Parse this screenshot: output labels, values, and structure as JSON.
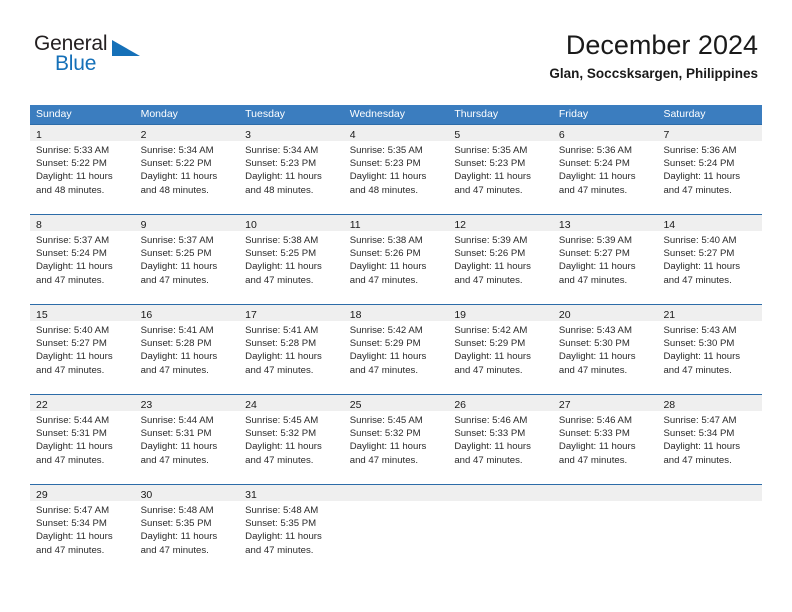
{
  "brand": {
    "name_part1": "General",
    "name_part2": "Blue",
    "logo_icon": "triangle-logo-icon"
  },
  "header": {
    "title": "December 2024",
    "location": "Glan, Soccsksargen, Philippines"
  },
  "colors": {
    "header_blue": "#3b7dbf",
    "row_divider_blue": "#2d6ca8",
    "day_band_gray": "#efefef",
    "brand_blue": "#1570b8",
    "text": "#1a1a1a"
  },
  "weekdays": [
    "Sunday",
    "Monday",
    "Tuesday",
    "Wednesday",
    "Thursday",
    "Friday",
    "Saturday"
  ],
  "weeks": [
    [
      {
        "day": "1",
        "sunrise": "Sunrise: 5:33 AM",
        "sunset": "Sunset: 5:22 PM",
        "daylight_line1": "Daylight: 11 hours",
        "daylight_line2": "and 48 minutes."
      },
      {
        "day": "2",
        "sunrise": "Sunrise: 5:34 AM",
        "sunset": "Sunset: 5:22 PM",
        "daylight_line1": "Daylight: 11 hours",
        "daylight_line2": "and 48 minutes."
      },
      {
        "day": "3",
        "sunrise": "Sunrise: 5:34 AM",
        "sunset": "Sunset: 5:23 PM",
        "daylight_line1": "Daylight: 11 hours",
        "daylight_line2": "and 48 minutes."
      },
      {
        "day": "4",
        "sunrise": "Sunrise: 5:35 AM",
        "sunset": "Sunset: 5:23 PM",
        "daylight_line1": "Daylight: 11 hours",
        "daylight_line2": "and 48 minutes."
      },
      {
        "day": "5",
        "sunrise": "Sunrise: 5:35 AM",
        "sunset": "Sunset: 5:23 PM",
        "daylight_line1": "Daylight: 11 hours",
        "daylight_line2": "and 47 minutes."
      },
      {
        "day": "6",
        "sunrise": "Sunrise: 5:36 AM",
        "sunset": "Sunset: 5:24 PM",
        "daylight_line1": "Daylight: 11 hours",
        "daylight_line2": "and 47 minutes."
      },
      {
        "day": "7",
        "sunrise": "Sunrise: 5:36 AM",
        "sunset": "Sunset: 5:24 PM",
        "daylight_line1": "Daylight: 11 hours",
        "daylight_line2": "and 47 minutes."
      }
    ],
    [
      {
        "day": "8",
        "sunrise": "Sunrise: 5:37 AM",
        "sunset": "Sunset: 5:24 PM",
        "daylight_line1": "Daylight: 11 hours",
        "daylight_line2": "and 47 minutes."
      },
      {
        "day": "9",
        "sunrise": "Sunrise: 5:37 AM",
        "sunset": "Sunset: 5:25 PM",
        "daylight_line1": "Daylight: 11 hours",
        "daylight_line2": "and 47 minutes."
      },
      {
        "day": "10",
        "sunrise": "Sunrise: 5:38 AM",
        "sunset": "Sunset: 5:25 PM",
        "daylight_line1": "Daylight: 11 hours",
        "daylight_line2": "and 47 minutes."
      },
      {
        "day": "11",
        "sunrise": "Sunrise: 5:38 AM",
        "sunset": "Sunset: 5:26 PM",
        "daylight_line1": "Daylight: 11 hours",
        "daylight_line2": "and 47 minutes."
      },
      {
        "day": "12",
        "sunrise": "Sunrise: 5:39 AM",
        "sunset": "Sunset: 5:26 PM",
        "daylight_line1": "Daylight: 11 hours",
        "daylight_line2": "and 47 minutes."
      },
      {
        "day": "13",
        "sunrise": "Sunrise: 5:39 AM",
        "sunset": "Sunset: 5:27 PM",
        "daylight_line1": "Daylight: 11 hours",
        "daylight_line2": "and 47 minutes."
      },
      {
        "day": "14",
        "sunrise": "Sunrise: 5:40 AM",
        "sunset": "Sunset: 5:27 PM",
        "daylight_line1": "Daylight: 11 hours",
        "daylight_line2": "and 47 minutes."
      }
    ],
    [
      {
        "day": "15",
        "sunrise": "Sunrise: 5:40 AM",
        "sunset": "Sunset: 5:27 PM",
        "daylight_line1": "Daylight: 11 hours",
        "daylight_line2": "and 47 minutes."
      },
      {
        "day": "16",
        "sunrise": "Sunrise: 5:41 AM",
        "sunset": "Sunset: 5:28 PM",
        "daylight_line1": "Daylight: 11 hours",
        "daylight_line2": "and 47 minutes."
      },
      {
        "day": "17",
        "sunrise": "Sunrise: 5:41 AM",
        "sunset": "Sunset: 5:28 PM",
        "daylight_line1": "Daylight: 11 hours",
        "daylight_line2": "and 47 minutes."
      },
      {
        "day": "18",
        "sunrise": "Sunrise: 5:42 AM",
        "sunset": "Sunset: 5:29 PM",
        "daylight_line1": "Daylight: 11 hours",
        "daylight_line2": "and 47 minutes."
      },
      {
        "day": "19",
        "sunrise": "Sunrise: 5:42 AM",
        "sunset": "Sunset: 5:29 PM",
        "daylight_line1": "Daylight: 11 hours",
        "daylight_line2": "and 47 minutes."
      },
      {
        "day": "20",
        "sunrise": "Sunrise: 5:43 AM",
        "sunset": "Sunset: 5:30 PM",
        "daylight_line1": "Daylight: 11 hours",
        "daylight_line2": "and 47 minutes."
      },
      {
        "day": "21",
        "sunrise": "Sunrise: 5:43 AM",
        "sunset": "Sunset: 5:30 PM",
        "daylight_line1": "Daylight: 11 hours",
        "daylight_line2": "and 47 minutes."
      }
    ],
    [
      {
        "day": "22",
        "sunrise": "Sunrise: 5:44 AM",
        "sunset": "Sunset: 5:31 PM",
        "daylight_line1": "Daylight: 11 hours",
        "daylight_line2": "and 47 minutes."
      },
      {
        "day": "23",
        "sunrise": "Sunrise: 5:44 AM",
        "sunset": "Sunset: 5:31 PM",
        "daylight_line1": "Daylight: 11 hours",
        "daylight_line2": "and 47 minutes."
      },
      {
        "day": "24",
        "sunrise": "Sunrise: 5:45 AM",
        "sunset": "Sunset: 5:32 PM",
        "daylight_line1": "Daylight: 11 hours",
        "daylight_line2": "and 47 minutes."
      },
      {
        "day": "25",
        "sunrise": "Sunrise: 5:45 AM",
        "sunset": "Sunset: 5:32 PM",
        "daylight_line1": "Daylight: 11 hours",
        "daylight_line2": "and 47 minutes."
      },
      {
        "day": "26",
        "sunrise": "Sunrise: 5:46 AM",
        "sunset": "Sunset: 5:33 PM",
        "daylight_line1": "Daylight: 11 hours",
        "daylight_line2": "and 47 minutes."
      },
      {
        "day": "27",
        "sunrise": "Sunrise: 5:46 AM",
        "sunset": "Sunset: 5:33 PM",
        "daylight_line1": "Daylight: 11 hours",
        "daylight_line2": "and 47 minutes."
      },
      {
        "day": "28",
        "sunrise": "Sunrise: 5:47 AM",
        "sunset": "Sunset: 5:34 PM",
        "daylight_line1": "Daylight: 11 hours",
        "daylight_line2": "and 47 minutes."
      }
    ],
    [
      {
        "day": "29",
        "sunrise": "Sunrise: 5:47 AM",
        "sunset": "Sunset: 5:34 PM",
        "daylight_line1": "Daylight: 11 hours",
        "daylight_line2": "and 47 minutes."
      },
      {
        "day": "30",
        "sunrise": "Sunrise: 5:48 AM",
        "sunset": "Sunset: 5:35 PM",
        "daylight_line1": "Daylight: 11 hours",
        "daylight_line2": "and 47 minutes."
      },
      {
        "day": "31",
        "sunrise": "Sunrise: 5:48 AM",
        "sunset": "Sunset: 5:35 PM",
        "daylight_line1": "Daylight: 11 hours",
        "daylight_line2": "and 47 minutes."
      },
      {
        "day": "",
        "sunrise": "",
        "sunset": "",
        "daylight_line1": "",
        "daylight_line2": ""
      },
      {
        "day": "",
        "sunrise": "",
        "sunset": "",
        "daylight_line1": "",
        "daylight_line2": ""
      },
      {
        "day": "",
        "sunrise": "",
        "sunset": "",
        "daylight_line1": "",
        "daylight_line2": ""
      },
      {
        "day": "",
        "sunrise": "",
        "sunset": "",
        "daylight_line1": "",
        "daylight_line2": ""
      }
    ]
  ]
}
